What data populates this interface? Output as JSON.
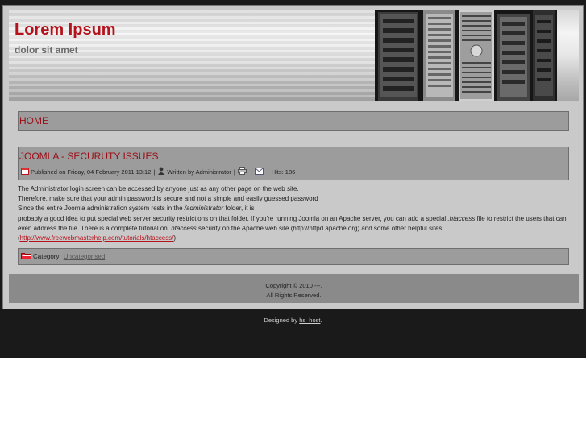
{
  "site": {
    "title": "Lorem Ipsum",
    "slogan": "dolor sit amet"
  },
  "menu": {
    "items": [
      {
        "label": "HOME"
      }
    ]
  },
  "article": {
    "title": "JOOMLA - SECURUTY ISSUES",
    "meta": {
      "published": "Published on Friday, 04 February 2011 13:12",
      "author": "Written by Administrator",
      "hits": "Hits: 186",
      "separator": "|",
      "icons": {
        "date": "calendar-icon",
        "author": "user-icon",
        "print": "print-icon",
        "email": "email-icon"
      }
    },
    "body": {
      "line1": "The Administrator login screen can be accessed by anyone just as any other page on the web site.",
      "line2": "Therefore, make sure that your admin password is secure and not a simple and easily guessed password",
      "line3_a": "Since the entire Joomla administration system rests in the ",
      "line3_em": "/administrator",
      "line3_b": " folder, it is",
      "line4_a": "probably a good idea to put special web server security restrictions on that folder. If you're running Joomla on an Apache server, you can add a special ",
      "line4_em": ".htaccess",
      "line4_b": " file to restrict the users that can even address the file. There is a complete tutorial on ",
      "line4_em2": ".htaccess",
      "line4_c": " security on the Apache web site (http://httpd.apache.org) and some other helpful sites (",
      "link": "http://www.freewebmasterhelp.com/tutorials/htaccess/",
      "line4_end": ")"
    },
    "category": {
      "label": "Category:",
      "value": "Uncategorised",
      "icon": "folder-icon"
    }
  },
  "footer": {
    "copyright": "Copyright © 2010 ---.",
    "rights": "All Rights Reserved.",
    "designed_prefix": "Designed by",
    "designed_link": "hs_host",
    "designed_suffix": "."
  },
  "colors": {
    "accent": "#b5121b",
    "panel": "#9c9c9c",
    "page_bg": "#c9c9c9",
    "outer_bg": "#1a1a1a"
  }
}
